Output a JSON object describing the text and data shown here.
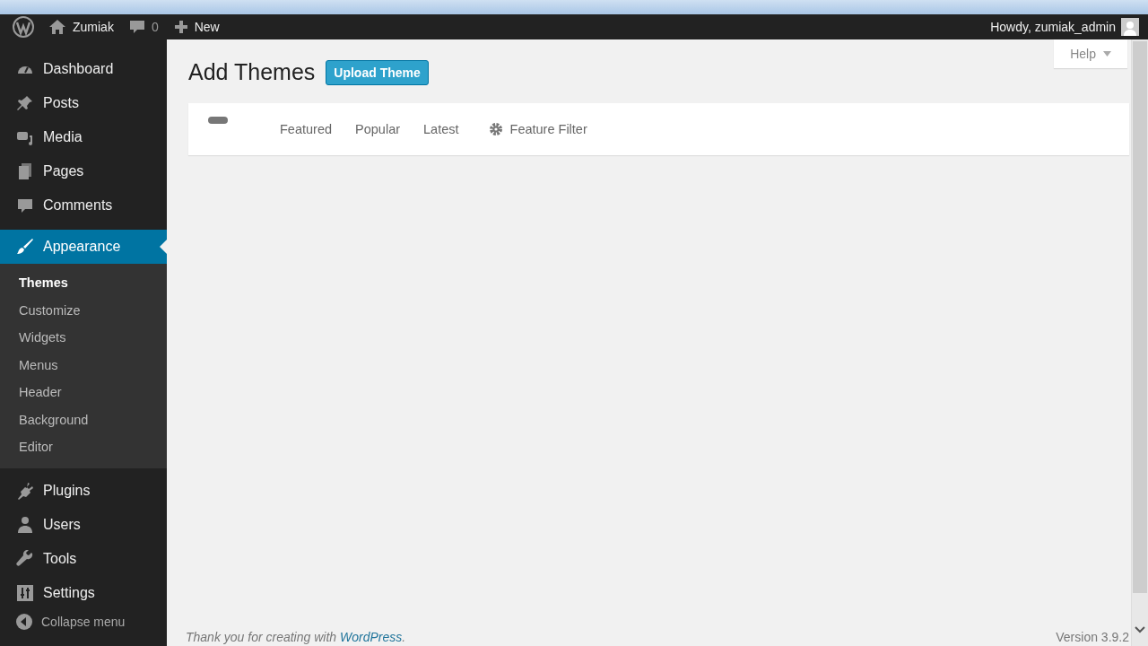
{
  "admin_bar": {
    "site_name": "Zumiak",
    "comments_count": "0",
    "new_label": "New",
    "greeting": "Howdy, zumiak_admin"
  },
  "sidebar": {
    "items": [
      {
        "label": "Dashboard",
        "selected": false
      },
      {
        "label": "Posts",
        "selected": false
      },
      {
        "label": "Media",
        "selected": false
      },
      {
        "label": "Pages",
        "selected": false
      },
      {
        "label": "Comments",
        "selected": false
      },
      {
        "label": "Appearance",
        "selected": true,
        "children": [
          {
            "label": "Themes",
            "selected": true
          },
          {
            "label": "Customize",
            "selected": false
          },
          {
            "label": "Widgets",
            "selected": false
          },
          {
            "label": "Menus",
            "selected": false
          },
          {
            "label": "Header",
            "selected": false
          },
          {
            "label": "Background",
            "selected": false
          },
          {
            "label": "Editor",
            "selected": false
          }
        ]
      },
      {
        "label": "Plugins",
        "selected": false
      },
      {
        "label": "Users",
        "selected": false
      },
      {
        "label": "Tools",
        "selected": false
      },
      {
        "label": "Settings",
        "selected": false
      }
    ],
    "collapse_label": "Collapse menu"
  },
  "page": {
    "title": "Add Themes",
    "upload_button": "Upload Theme",
    "help_button": "Help",
    "filter_tabs": [
      {
        "label": "Featured",
        "selected": false
      },
      {
        "label": "Popular",
        "selected": false
      },
      {
        "label": "Latest",
        "selected": false
      }
    ],
    "feature_filter": "Feature Filter"
  },
  "footer": {
    "thanks": "Thank you for creating with ",
    "link": "WordPress",
    "thanks_end": ".",
    "version": "Version 3.9.2"
  }
}
